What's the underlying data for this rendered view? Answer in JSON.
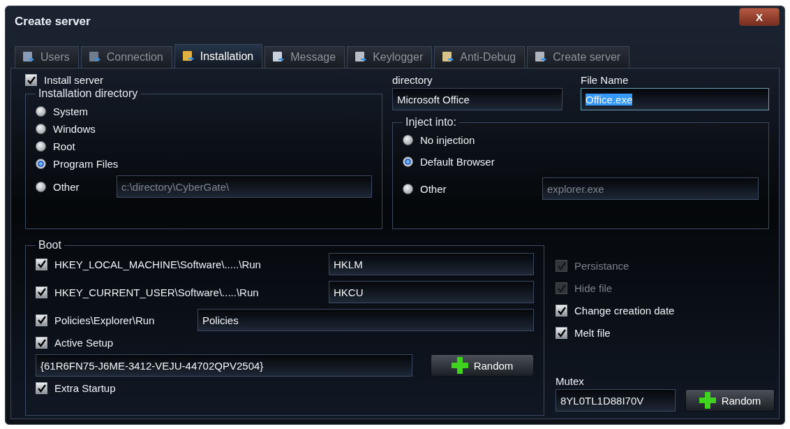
{
  "window": {
    "title": "Create server",
    "close": "X"
  },
  "tabs": [
    {
      "label": "Users",
      "selected": false
    },
    {
      "label": "Connection",
      "selected": false
    },
    {
      "label": "Installation",
      "selected": true
    },
    {
      "label": "Message",
      "selected": false
    },
    {
      "label": "Keylogger",
      "selected": false
    },
    {
      "label": "Anti-Debug",
      "selected": false
    },
    {
      "label": "Create server",
      "selected": false
    }
  ],
  "install_server": {
    "label": "Install server",
    "checked": true
  },
  "installation_directory": {
    "title": "Installation directory",
    "options": [
      {
        "label": "System",
        "selected": false
      },
      {
        "label": "Windows",
        "selected": false
      },
      {
        "label": "Root",
        "selected": false
      },
      {
        "label": "Program Files",
        "selected": true
      },
      {
        "label": "Other",
        "selected": false
      }
    ],
    "other_path": "c:\\directory\\CyberGate\\"
  },
  "directory": {
    "label": "directory",
    "value": "Microsoft Office"
  },
  "file_name": {
    "label": "File Name",
    "value": "Office.exe"
  },
  "inject_into": {
    "title": "Inject into:",
    "options": [
      {
        "label": "No injection",
        "selected": false
      },
      {
        "label": "Default Browser",
        "selected": true
      },
      {
        "label": "Other",
        "selected": false
      }
    ],
    "other_process": "explorer.exe"
  },
  "boot": {
    "title": "Boot",
    "entries": [
      {
        "label": "HKEY_LOCAL_MACHINE\\Software\\.....\\Run",
        "checked": true,
        "value": "HKLM"
      },
      {
        "label": "HKEY_CURRENT_USER\\Software\\.....\\Run",
        "checked": true,
        "value": "HKCU"
      },
      {
        "label": "Policies\\Explorer\\Run",
        "checked": true,
        "value": "Policies"
      }
    ],
    "active_setup": {
      "label": "Active Setup",
      "checked": true,
      "value": "{61R6FN75-J6ME-3412-VEJU-44702QPV2504}",
      "button": "Random"
    },
    "extra_startup": {
      "label": "Extra Startup",
      "checked": true
    }
  },
  "options": [
    {
      "label": "Persistance",
      "checked": true,
      "disabled": true
    },
    {
      "label": "Hide file",
      "checked": true,
      "disabled": true
    },
    {
      "label": "Change creation date",
      "checked": true,
      "disabled": false
    },
    {
      "label": "Melt file",
      "checked": true,
      "disabled": false
    }
  ],
  "mutex": {
    "label": "Mutex",
    "value": "8YL0TL1D88I70V",
    "button": "Random"
  }
}
